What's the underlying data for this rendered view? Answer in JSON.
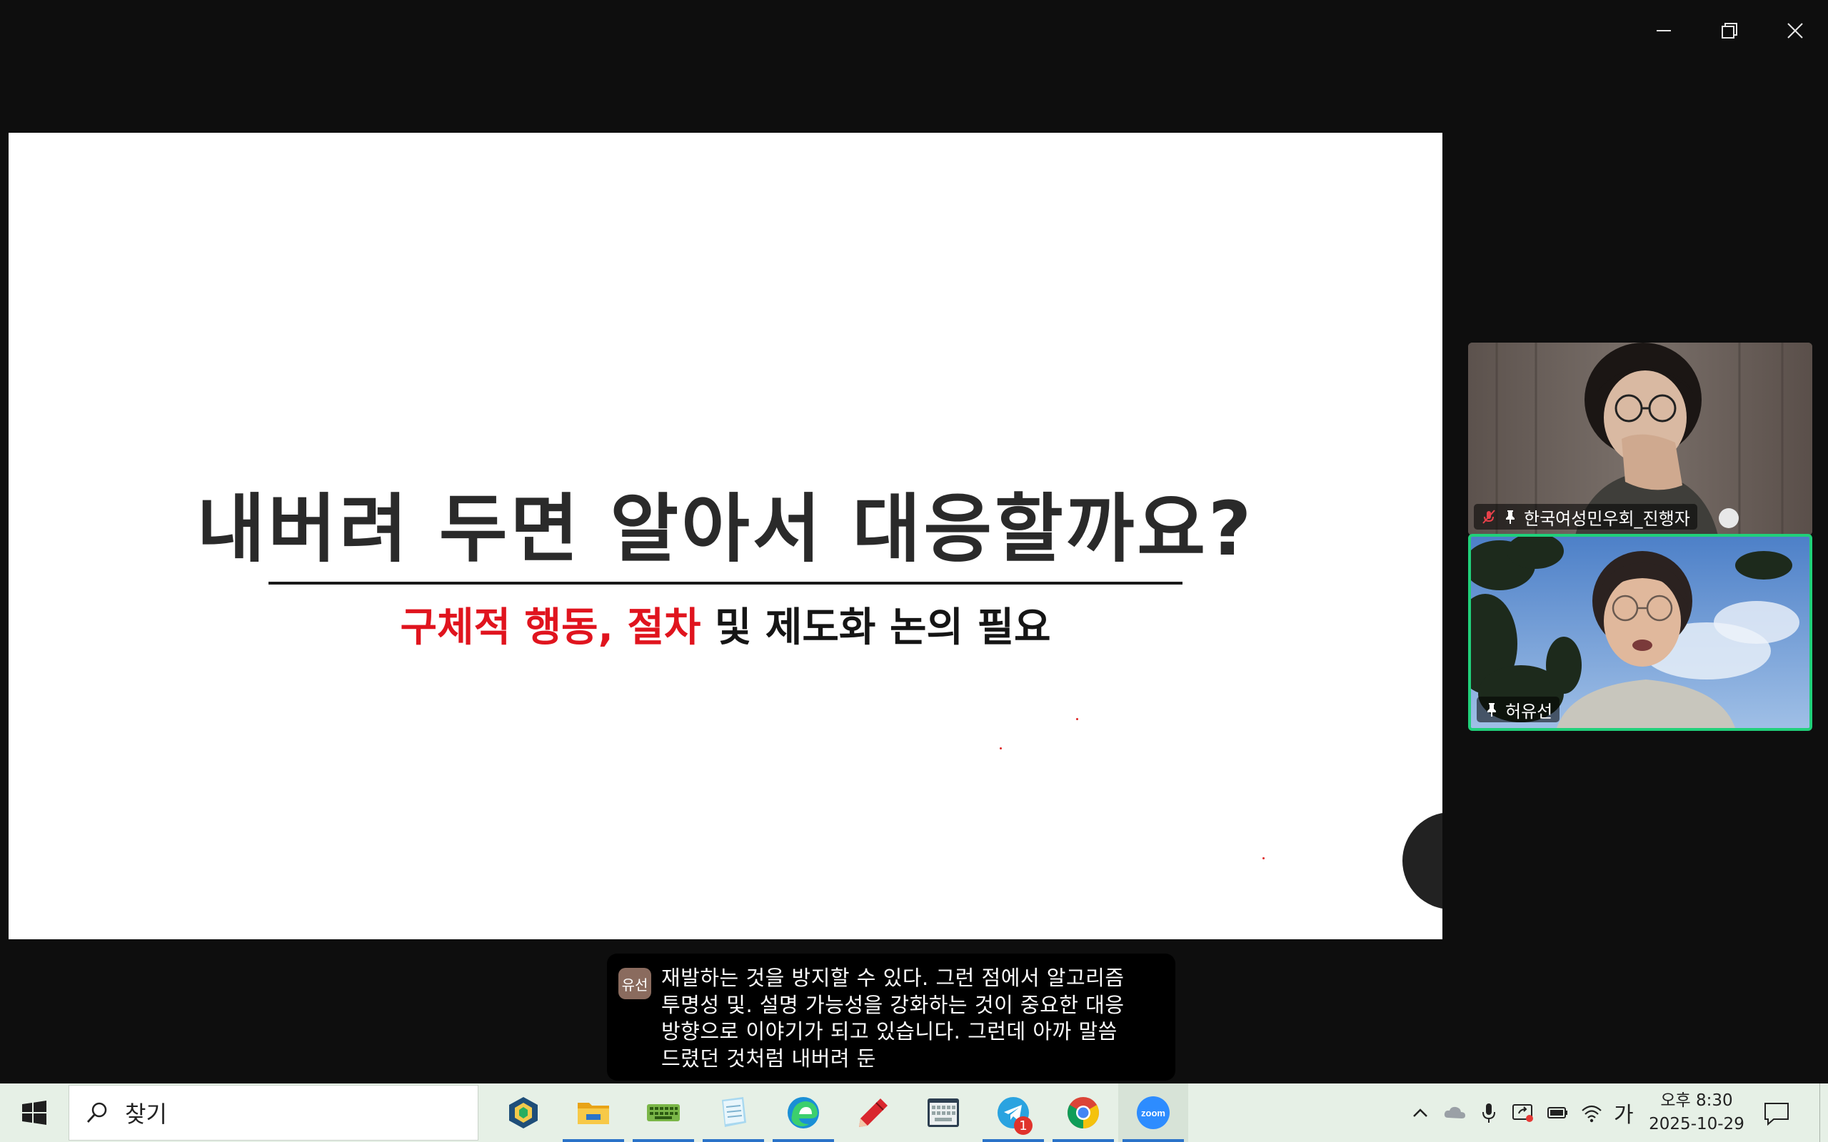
{
  "window": {
    "minimize_label": "Minimize",
    "restore_label": "Restore",
    "close_label": "Close"
  },
  "slide": {
    "title": "내버려 두면 알아서 대응할까요?",
    "subtitle_red": "구체적 행동, 절차",
    "subtitle_dark": " 및 제도화 논의 필요"
  },
  "participants": [
    {
      "name": "한국여성민우회_진행자",
      "muted": true,
      "pinned": true,
      "speaking": false
    },
    {
      "name": "허유선",
      "muted": false,
      "pinned": true,
      "speaking": true
    }
  ],
  "caption": {
    "speaker_initials": "유선",
    "lines": [
      "재발하는 것을 방지할 수 있다. 그런 점에서 알고리즘",
      "투명성 및. 설명 가능성을 강화하는 것이 중요한 대응",
      "방향으로 이야기가 되고 있습니다. 그런데 아까 말씀",
      "드렸던 것처럼 내버려 둔"
    ]
  },
  "taskbar": {
    "search_placeholder": "찾기",
    "apps": [
      {
        "icon": "copilot-app-icon",
        "active": false
      },
      {
        "icon": "file-explorer-icon",
        "active": true
      },
      {
        "icon": "keyboard-app-icon",
        "active": true
      },
      {
        "icon": "notepad-icon",
        "active": true
      },
      {
        "icon": "edge-browser-icon",
        "active": true
      },
      {
        "icon": "pen-app-icon",
        "active": false
      },
      {
        "icon": "screen-keyboard-icon",
        "active": false
      },
      {
        "icon": "telegram-icon",
        "active": true,
        "badge": "1"
      },
      {
        "icon": "chrome-icon",
        "active": true
      },
      {
        "icon": "zoom-icon",
        "active": true
      }
    ],
    "zoom_label": "zoom",
    "ime_label": "가",
    "clock_time": "오후 8:30",
    "clock_date": "2025-10-29"
  },
  "colors": {
    "accent_red": "#e0141e",
    "speaker_border": "#20d07a",
    "taskbar_bg": "#e6f0e6",
    "active_indicator": "#2b73c9"
  }
}
